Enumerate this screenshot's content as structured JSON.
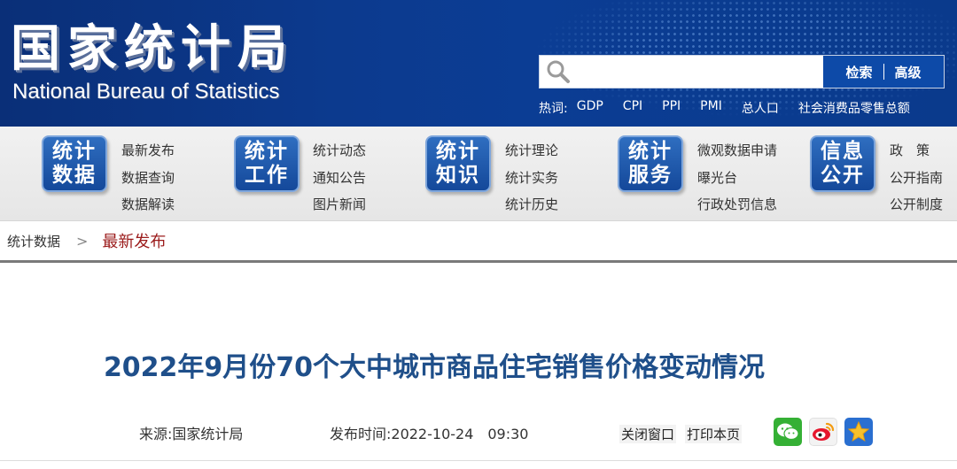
{
  "header": {
    "logo_cn": "国家统计局",
    "logo_en": "National Bureau of Statistics",
    "search": {
      "placeholder": "",
      "value": "",
      "search_label": "检索",
      "advanced_label": "高级"
    },
    "hotwords": {
      "label": "热词:",
      "items": [
        "GDP",
        "CPI",
        "PPI",
        "PMI",
        "总人口",
        "社会消费品零售总额"
      ]
    }
  },
  "nav": {
    "groups": [
      {
        "badge_line1": "统计",
        "badge_line2": "数据",
        "links": [
          "最新发布",
          "数据查询",
          "数据解读"
        ]
      },
      {
        "badge_line1": "统计",
        "badge_line2": "工作",
        "links": [
          "统计动态",
          "通知公告",
          "图片新闻"
        ]
      },
      {
        "badge_line1": "统计",
        "badge_line2": "知识",
        "links": [
          "统计理论",
          "统计实务",
          "统计历史"
        ]
      },
      {
        "badge_line1": "统计",
        "badge_line2": "服务",
        "links": [
          "微观数据申请",
          "曝光台",
          "行政处罚信息"
        ]
      },
      {
        "badge_line1": "信息",
        "badge_line2": "公开",
        "links": [
          "政　策",
          "公开指南",
          "公开制度"
        ]
      }
    ]
  },
  "breadcrumb": {
    "root": "统计数据",
    "separator": ">",
    "current": "最新发布"
  },
  "article": {
    "title": "2022年9月份70个大中城市商品住宅销售价格变动情况",
    "source": "来源:国家统计局",
    "publish_time": "发布时间:2022-10-24　09:30",
    "close_window_label": "关闭窗口",
    "print_label": "打印本页",
    "share_icons": [
      "wechat-icon",
      "weibo-icon",
      "qzone-icon"
    ]
  },
  "colors": {
    "header_blue": "#0c3a8e",
    "search_button": "#0d4aa8",
    "title_blue": "#1f4f8a",
    "breadcrumb_red": "#9b1b1b"
  }
}
